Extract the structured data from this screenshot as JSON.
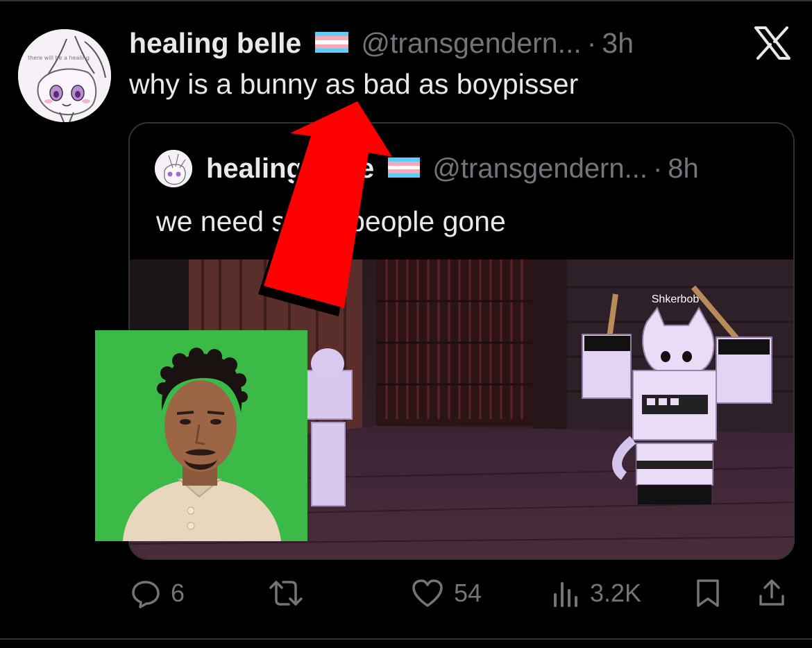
{
  "tweet": {
    "author_name": "healing belle",
    "handle": "@transgendern...",
    "separator": "·",
    "time": "3h",
    "text": "why is a bunny as bad as boypisser",
    "avatar_caption": "there will be a healing"
  },
  "quoted_tweet": {
    "author_name": "healing belle",
    "handle": "@transgendern...",
    "separator": "·",
    "time": "8h",
    "text": "we need some people gone",
    "media": {
      "player_name_tag": "Shkerbob"
    }
  },
  "actions": {
    "reply_count": "6",
    "retweet_count": "",
    "like_count": "54",
    "views_count": "3.2K"
  },
  "colors": {
    "background": "#000000",
    "primary_text": "#e7e9ea",
    "secondary_text": "#71767b",
    "border": "#2f3336",
    "arrow": "#ff0000",
    "flag_blue": "#5bcefa",
    "flag_pink": "#f5a9b8",
    "green_screen": "#3cba47"
  },
  "icons": [
    "x-logo-icon",
    "trans-flag-icon",
    "reply-icon",
    "retweet-icon",
    "like-icon",
    "views-icon",
    "bookmark-icon",
    "share-icon",
    "red-arrow-icon"
  ]
}
